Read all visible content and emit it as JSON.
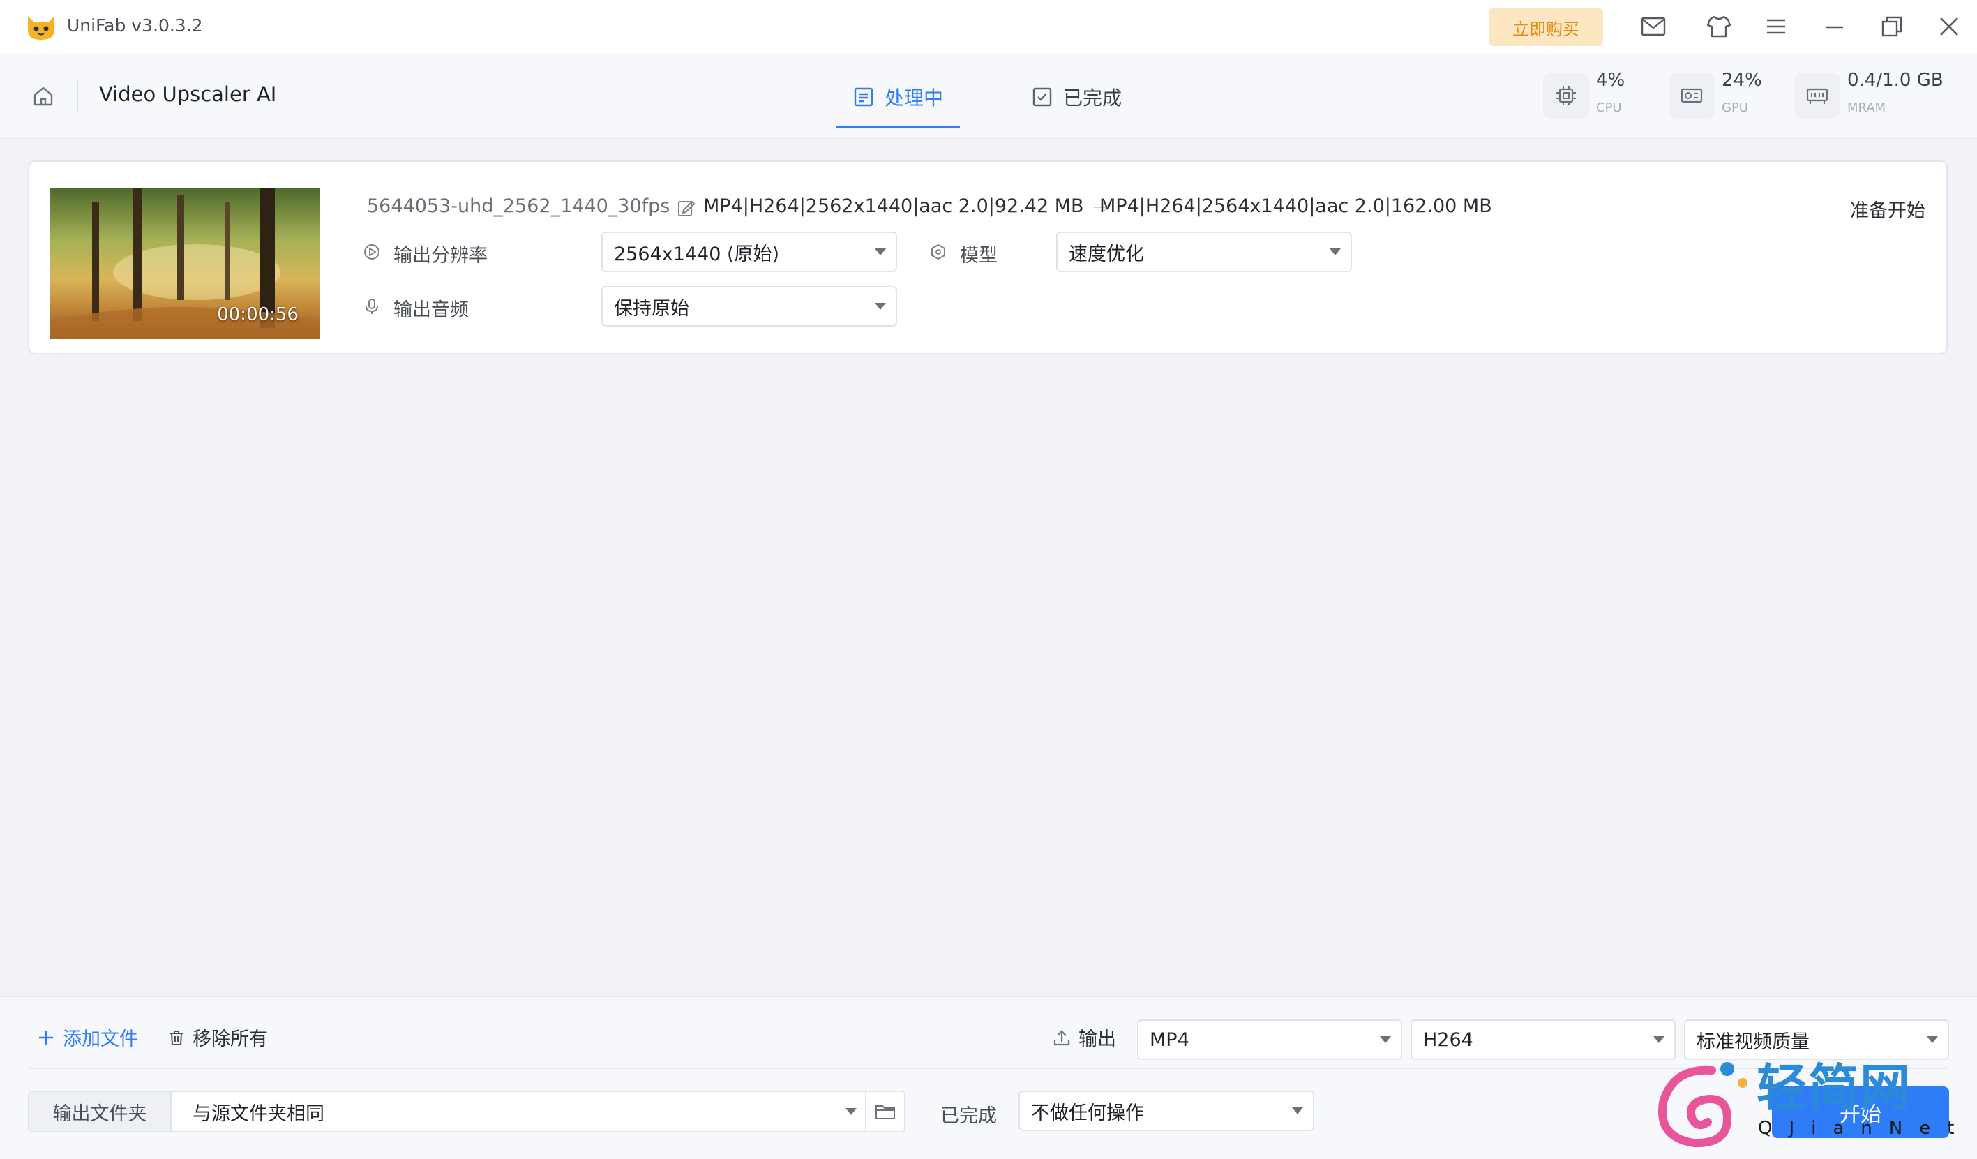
{
  "titlebar": {
    "app_name": "UniFab v3.0.3.2",
    "buy_label": "立即购买",
    "icons": [
      "app-logo-icon",
      "mail-icon",
      "tshirt-icon",
      "menu-icon",
      "minimize-icon",
      "restore-icon",
      "close-icon"
    ]
  },
  "header": {
    "module_title": "Video Upscaler AI",
    "tabs": [
      {
        "label": "处理中",
        "active": true
      },
      {
        "label": "已完成",
        "active": false
      }
    ],
    "stats": [
      {
        "value": "4%",
        "label": "CPU"
      },
      {
        "value": "24%",
        "label": "GPU"
      },
      {
        "value": "0.4/1.0 GB",
        "label": "MRAM"
      }
    ]
  },
  "task": {
    "duration": "00:00:56",
    "file_name": "5644053-uhd_2562_1440_30fps",
    "source_info": "MP4|H264|2562x1440|aac 2.0|92.42 MB",
    "output_info": "MP4|H264|2564x1440|aac 2.0|162.00 MB",
    "status": "准备开始",
    "resolution_label": "输出分辨率",
    "resolution_value": "2564x1440 (原始)",
    "model_label": "模型",
    "model_value": "速度优化",
    "audio_label": "输出音频",
    "audio_value": "保持原始"
  },
  "bottom": {
    "add_file_label": "添加文件",
    "remove_all_label": "移除所有",
    "output_label": "输出",
    "format_value": "MP4",
    "codec_value": "H264",
    "quality_value": "标准视频质量",
    "output_folder_label": "输出文件夹",
    "output_folder_value": "与源文件夹相同",
    "on_complete_label": "已完成",
    "on_complete_value": "不做任何操作",
    "start_label": "开始"
  },
  "watermark": {
    "cn": "轻简网",
    "en": "QJianNet"
  },
  "colors": {
    "accent": "#2f7df6",
    "buy_bg": "#fde6c2",
    "buy_text": "#e78a12",
    "background": "#f1f3f9"
  }
}
